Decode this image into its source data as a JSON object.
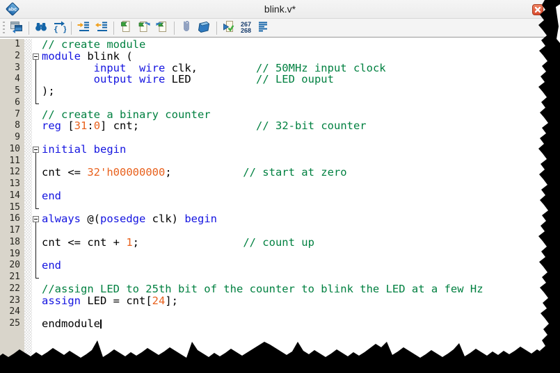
{
  "window": {
    "title": "blink.v*"
  },
  "toolbar": {
    "items": [
      {
        "type": "grip",
        "name": "toolbar-grip"
      },
      {
        "type": "button",
        "name": "switch-view",
        "icon": "window-swap-icon"
      },
      {
        "type": "separator"
      },
      {
        "type": "button",
        "name": "find",
        "icon": "binoculars-icon"
      },
      {
        "type": "button",
        "name": "goto-matching-brace",
        "icon": "braces-arrow-icon"
      },
      {
        "type": "separator"
      },
      {
        "type": "button",
        "name": "indent",
        "icon": "indent-icon"
      },
      {
        "type": "button",
        "name": "unindent",
        "icon": "unindent-icon"
      },
      {
        "type": "separator"
      },
      {
        "type": "button",
        "name": "toggle-bookmark",
        "icon": "bookmark-doc-icon"
      },
      {
        "type": "button",
        "name": "next-bookmark",
        "icon": "bookmark-next-icon"
      },
      {
        "type": "button",
        "name": "prev-bookmark",
        "icon": "bookmark-prev-icon"
      },
      {
        "type": "separator"
      },
      {
        "type": "button",
        "name": "attach",
        "icon": "paperclip-icon"
      },
      {
        "type": "button",
        "name": "snippet",
        "icon": "blue-ribbon-icon"
      },
      {
        "type": "separator"
      },
      {
        "type": "button",
        "name": "syntax-check",
        "icon": "check-doc-icon"
      },
      {
        "type": "indicator",
        "name": "line-count-indicator",
        "lines": [
          "267",
          "268"
        ]
      },
      {
        "type": "button",
        "name": "line-operations",
        "icon": "text-lines-icon"
      }
    ]
  },
  "editor": {
    "caret_line": 25,
    "lines": [
      {
        "n": 1,
        "fold": "none",
        "tokens": [
          [
            "com",
            "// create module"
          ]
        ]
      },
      {
        "n": 2,
        "fold": "box",
        "tokens": [
          [
            "kw",
            "module"
          ],
          [
            "pl",
            " blink ("
          ]
        ]
      },
      {
        "n": 3,
        "fold": "line",
        "tokens": [
          [
            "pl",
            "        "
          ],
          [
            "kw",
            "input"
          ],
          [
            "pl",
            "  "
          ],
          [
            "kw",
            "wire"
          ],
          [
            "pl",
            " clk,         "
          ],
          [
            "com",
            "// 50MHz input clock"
          ]
        ]
      },
      {
        "n": 4,
        "fold": "line",
        "tokens": [
          [
            "pl",
            "        "
          ],
          [
            "kw",
            "output"
          ],
          [
            "pl",
            " "
          ],
          [
            "kw",
            "wire"
          ],
          [
            "pl",
            " LED          "
          ],
          [
            "com",
            "// LED ouput"
          ]
        ]
      },
      {
        "n": 5,
        "fold": "line",
        "tokens": [
          [
            "pl",
            ");"
          ]
        ]
      },
      {
        "n": 6,
        "fold": "corner",
        "tokens": []
      },
      {
        "n": 7,
        "fold": "none",
        "tokens": [
          [
            "com",
            "// create a binary counter"
          ]
        ]
      },
      {
        "n": 8,
        "fold": "none",
        "tokens": [
          [
            "kw",
            "reg"
          ],
          [
            "pl",
            " ["
          ],
          [
            "num",
            "31"
          ],
          [
            "pl",
            ":"
          ],
          [
            "num",
            "0"
          ],
          [
            "pl",
            "] cnt;                  "
          ],
          [
            "com",
            "// 32-bit counter"
          ]
        ]
      },
      {
        "n": 9,
        "fold": "none",
        "tokens": []
      },
      {
        "n": 10,
        "fold": "box",
        "tokens": [
          [
            "kw",
            "initial"
          ],
          [
            "pl",
            " "
          ],
          [
            "kw",
            "begin"
          ]
        ]
      },
      {
        "n": 11,
        "fold": "line",
        "tokens": []
      },
      {
        "n": 12,
        "fold": "line",
        "tokens": [
          [
            "pl",
            "cnt <= "
          ],
          [
            "num",
            "32'h00000000"
          ],
          [
            "pl",
            ";           "
          ],
          [
            "com",
            "// start at zero"
          ]
        ]
      },
      {
        "n": 13,
        "fold": "line",
        "tokens": []
      },
      {
        "n": 14,
        "fold": "line",
        "tokens": [
          [
            "kw",
            "end"
          ]
        ]
      },
      {
        "n": 15,
        "fold": "corner",
        "tokens": []
      },
      {
        "n": 16,
        "fold": "box",
        "tokens": [
          [
            "kw",
            "always"
          ],
          [
            "pl",
            " @("
          ],
          [
            "kw",
            "posedge"
          ],
          [
            "pl",
            " clk) "
          ],
          [
            "kw",
            "begin"
          ]
        ]
      },
      {
        "n": 17,
        "fold": "line",
        "tokens": []
      },
      {
        "n": 18,
        "fold": "line",
        "tokens": [
          [
            "pl",
            "cnt <= cnt + "
          ],
          [
            "num",
            "1"
          ],
          [
            "pl",
            ";                "
          ],
          [
            "com",
            "// count up"
          ]
        ]
      },
      {
        "n": 19,
        "fold": "line",
        "tokens": []
      },
      {
        "n": 20,
        "fold": "line",
        "tokens": [
          [
            "kw",
            "end"
          ]
        ]
      },
      {
        "n": 21,
        "fold": "corner",
        "tokens": []
      },
      {
        "n": 22,
        "fold": "none",
        "tokens": [
          [
            "com",
            "//assign LED to 25th bit of the counter to blink the LED at a few Hz"
          ]
        ]
      },
      {
        "n": 23,
        "fold": "none",
        "tokens": [
          [
            "kw",
            "assign"
          ],
          [
            "pl",
            " LED = cnt["
          ],
          [
            "num",
            "24"
          ],
          [
            "pl",
            "];"
          ]
        ]
      },
      {
        "n": 24,
        "fold": "none",
        "tokens": []
      },
      {
        "n": 25,
        "fold": "none",
        "tokens": [
          [
            "pl",
            "endmodule"
          ]
        ]
      }
    ]
  },
  "colors": {
    "keyword": "#1414e0",
    "comment": "#008040",
    "number": "#e8611d",
    "plain": "#000000",
    "gutter_bg": "#d9d5cb",
    "gutter_text": "#26251f",
    "icon_blue": "#1565a8",
    "close_red": "#d9482c",
    "torn_black": "#000000"
  }
}
